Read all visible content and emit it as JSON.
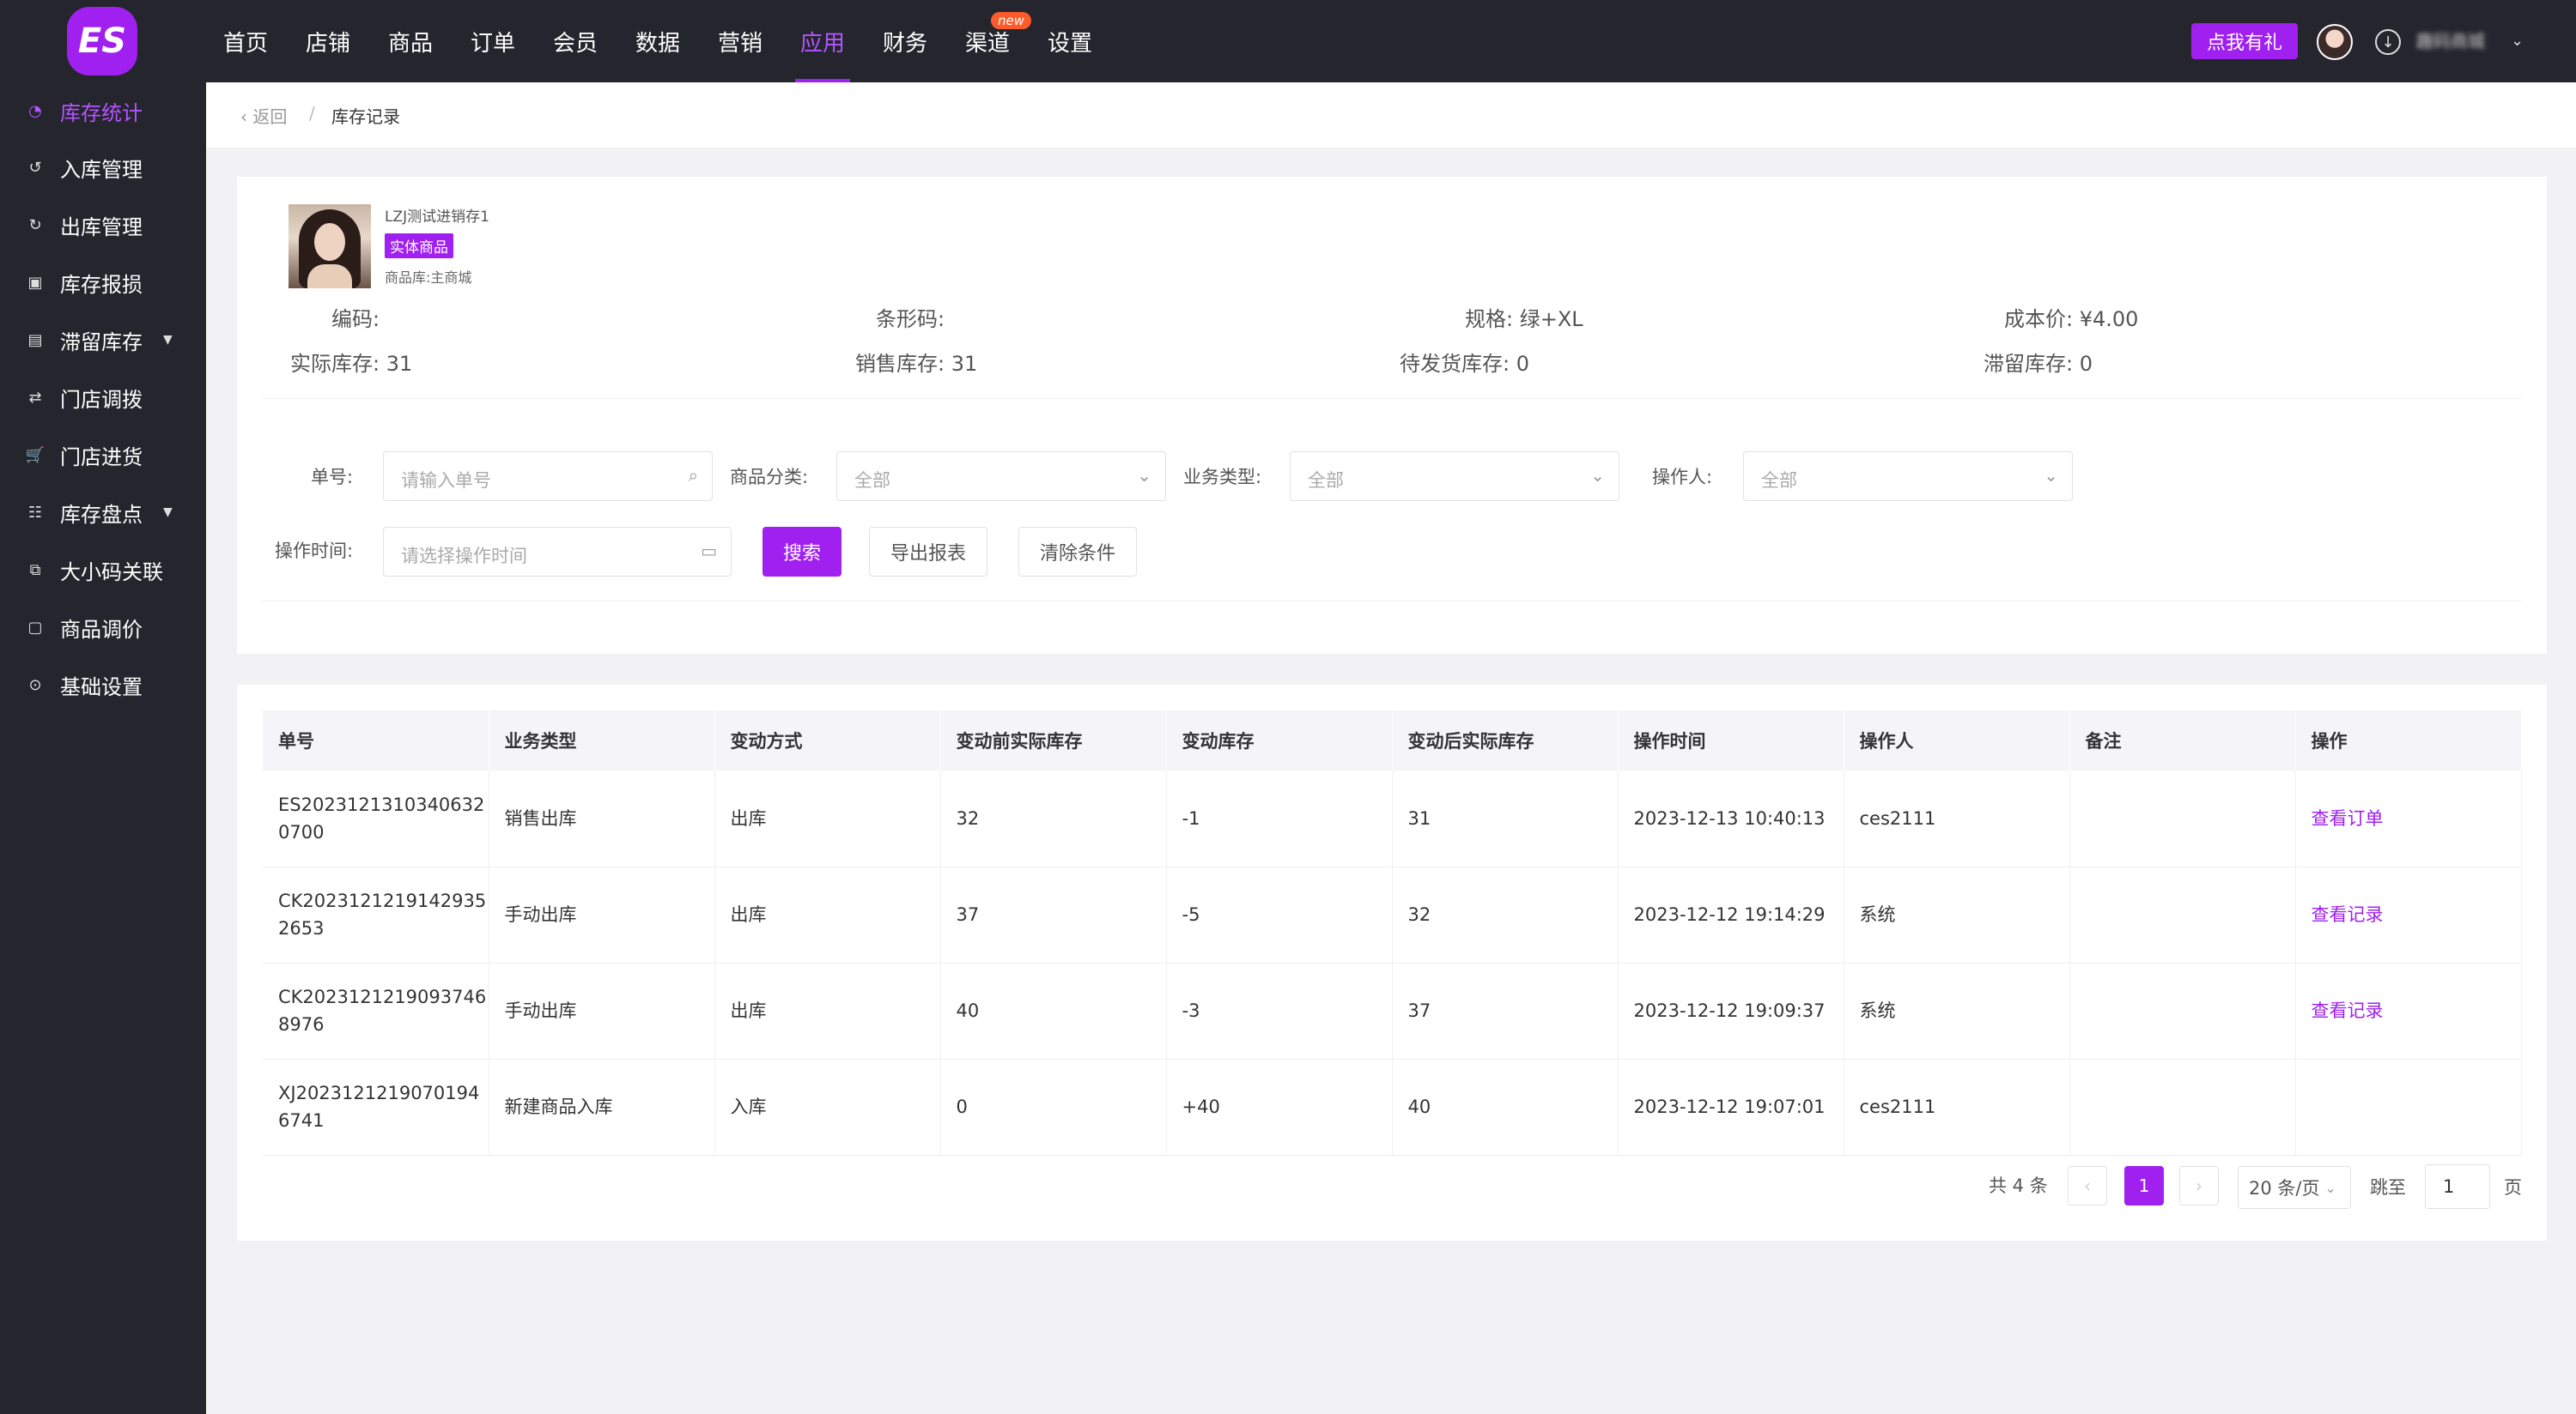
{
  "topbar": {
    "logo_text": "ES",
    "nav": [
      {
        "label": "首页"
      },
      {
        "label": "店铺"
      },
      {
        "label": "商品"
      },
      {
        "label": "订单"
      },
      {
        "label": "会员"
      },
      {
        "label": "数据"
      },
      {
        "label": "营销"
      },
      {
        "label": "应用",
        "active": true
      },
      {
        "label": "财务"
      },
      {
        "label": "渠道",
        "badge": "new"
      },
      {
        "label": "设置"
      }
    ],
    "gift_button": "点我有礼",
    "user_name": "趣码商城",
    "accent_color": "#a020f0"
  },
  "sidebar": {
    "items": [
      {
        "label": "库存统计",
        "icon": "pie-chart-icon",
        "active": true
      },
      {
        "label": "入库管理",
        "icon": "inbound-icon"
      },
      {
        "label": "出库管理",
        "icon": "outbound-icon"
      },
      {
        "label": "库存报损",
        "icon": "loss-report-icon"
      },
      {
        "label": "滞留库存",
        "icon": "stagnant-stock-icon",
        "has_caret": true
      },
      {
        "label": "门店调拨",
        "icon": "transfer-icon"
      },
      {
        "label": "门店进货",
        "icon": "cart-icon"
      },
      {
        "label": "库存盘点",
        "icon": "inventory-check-icon",
        "has_caret": true
      },
      {
        "label": "大小码关联",
        "icon": "link-size-icon"
      },
      {
        "label": "商品调价",
        "icon": "price-adjust-icon"
      },
      {
        "label": "基础设置",
        "icon": "settings-icon"
      }
    ]
  },
  "breadcrumb": {
    "back": "返回",
    "separator": "/",
    "current": "库存记录"
  },
  "product": {
    "name": "LZJ测试进销存1",
    "tag": "实体商品",
    "store": "商品库:主商城",
    "code_label": "编码:",
    "barcode_label": "条形码:",
    "spec_label": "规格: 绿+XL",
    "cost_label": "成本价: ¥4.00",
    "actual_stock_label": "实际库存: 31",
    "sales_stock_label": "销售库存: 31",
    "pending_stock_label": "待发货库存: 0",
    "stagnant_stock_label": "滞留库存: 0"
  },
  "filters": {
    "order_no_label": "单号:",
    "order_no_placeholder": "请输入单号",
    "category_label": "商品分类:",
    "category_value": "全部",
    "biz_type_label": "业务类型:",
    "biz_type_value": "全部",
    "operator_label": "操作人:",
    "operator_value": "全部",
    "time_label": "操作时间:",
    "time_placeholder": "请选择操作时间",
    "search_button": "搜索",
    "export_button": "导出报表",
    "clear_button": "清除条件"
  },
  "table": {
    "columns": [
      "单号",
      "业务类型",
      "变动方式",
      "变动前实际库存",
      "变动库存",
      "变动后实际库存",
      "操作时间",
      "操作人",
      "备注",
      "操作"
    ],
    "rows": [
      {
        "no": "ES20231213103406320700",
        "biz": "销售出库",
        "mode": "出库",
        "before": "32",
        "change": "-1",
        "after": "31",
        "time": "2023-12-13 10:40:13",
        "operator": "ces2111",
        "remark": "",
        "action": "查看订单"
      },
      {
        "no": "CK20231212191429352653",
        "biz": "手动出库",
        "mode": "出库",
        "before": "37",
        "change": "-5",
        "after": "32",
        "time": "2023-12-12 19:14:29",
        "operator": "系统",
        "remark": "",
        "action": "查看记录"
      },
      {
        "no": "CK20231212190937468976",
        "biz": "手动出库",
        "mode": "出库",
        "before": "40",
        "change": "-3",
        "after": "37",
        "time": "2023-12-12 19:09:37",
        "operator": "系统",
        "remark": "",
        "action": "查看记录"
      },
      {
        "no": "XJ20231212190701946741",
        "biz": "新建商品入库",
        "mode": "入库",
        "before": "0",
        "change": "+40",
        "after": "40",
        "time": "2023-12-12 19:07:01",
        "operator": "ces2111",
        "remark": "",
        "action": ""
      }
    ]
  },
  "pagination": {
    "total": "共 4 条",
    "current_page": "1",
    "page_size": "20 条/页",
    "jump_label": "跳至",
    "jump_value": "1",
    "page_label": "页"
  }
}
